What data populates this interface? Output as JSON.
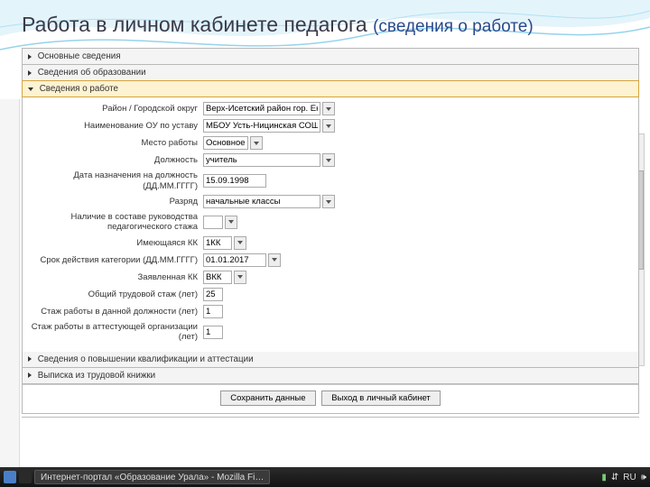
{
  "title": {
    "main": "Работа в личном кабинете педагога",
    "sub": "(сведения о работе)"
  },
  "sections": {
    "s1": "Основные сведения",
    "s2": "Сведения об образовании",
    "s3": "Сведения о работе",
    "s4": "Сведения о повышении квалификации и аттестации",
    "s5": "Выписка из трудовой книжки"
  },
  "fields": {
    "district": {
      "label": "Район / Городской округ",
      "value": "Верх-Исетский район гор. Ек"
    },
    "org_name": {
      "label": "Наименование ОУ по уставу",
      "value": "МБОУ Усть-Ницинская СОШ"
    },
    "workplace": {
      "label": "Место работы",
      "value": "Основное"
    },
    "position": {
      "label": "Должность",
      "value": "учитель"
    },
    "start_date": {
      "label": "Дата назначения на должность (ДД.ММ.ГГГГ)",
      "value": "15.09.1998"
    },
    "rate": {
      "label": "Разряд",
      "value": "начальные классы"
    },
    "mgmt": {
      "label": "Наличие в составе руководства педагогического стажа",
      "value": ""
    },
    "category": {
      "label": "Имеющаяся КК",
      "value": "1КК"
    },
    "cat_date": {
      "label": "Срок действия категории (ДД.ММ.ГГГГ)",
      "value": "01.01.2017"
    },
    "req_cat": {
      "label": "Заявленная КК",
      "value": "ВКК"
    },
    "total_exp": {
      "label": "Общий трудовой стаж (лет)",
      "value": "25"
    },
    "pos_exp": {
      "label": "Стаж работы в данной должности (лет)",
      "value": "1"
    },
    "attest_exp": {
      "label": "Стаж работы в аттестующей организации (лет)",
      "value": "1"
    }
  },
  "buttons": {
    "save": "Сохранить данные",
    "exit": "Выход в личный кабинет"
  },
  "taskbar": {
    "app1": "Интернет-портал «Образование Урала» - Mozilla Fi…",
    "tray_lang": "RU",
    "tray_net": "⇵"
  }
}
